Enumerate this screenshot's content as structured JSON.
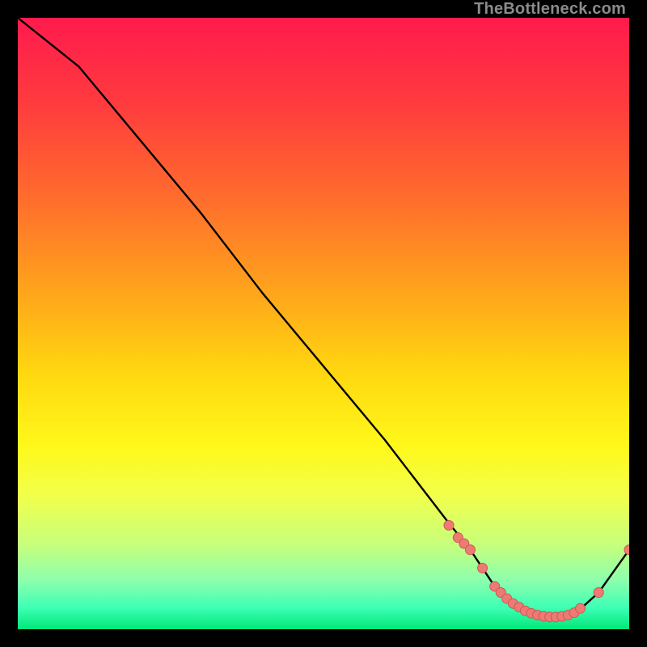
{
  "watermark": "TheBottleneck.com",
  "chart_data": {
    "type": "line",
    "title": "",
    "xlabel": "",
    "ylabel": "",
    "xlim": [
      0,
      100
    ],
    "ylim": [
      0,
      100
    ],
    "series": [
      {
        "name": "curve",
        "x": [
          0,
          5,
          10,
          20,
          30,
          40,
          50,
          60,
          70,
          74,
          78,
          80,
          82,
          85,
          88,
          90,
          92,
          95,
          100
        ],
        "y": [
          100,
          96,
          92,
          80,
          68,
          55,
          43,
          31,
          18,
          13,
          7,
          5,
          3.5,
          2.2,
          2.0,
          2.3,
          3.3,
          6.0,
          13
        ]
      }
    ],
    "markers": {
      "name": "dots",
      "x": [
        70.5,
        72,
        73,
        74,
        76,
        78,
        79,
        80,
        81,
        82,
        83,
        84,
        85,
        86,
        87,
        88,
        89,
        90,
        91,
        92,
        95,
        100
      ],
      "y": [
        17,
        15,
        14,
        13,
        10,
        7,
        6,
        5,
        4.2,
        3.6,
        3.0,
        2.6,
        2.3,
        2.1,
        2.0,
        2.0,
        2.1,
        2.3,
        2.7,
        3.4,
        6.0,
        13
      ]
    },
    "gradient_stops": [
      {
        "offset": 0.0,
        "color": "#ff1a4d"
      },
      {
        "offset": 0.14,
        "color": "#ff3b3e"
      },
      {
        "offset": 0.3,
        "color": "#ff6e2c"
      },
      {
        "offset": 0.45,
        "color": "#ffa51b"
      },
      {
        "offset": 0.58,
        "color": "#ffd710"
      },
      {
        "offset": 0.7,
        "color": "#fff81a"
      },
      {
        "offset": 0.78,
        "color": "#f2ff4a"
      },
      {
        "offset": 0.86,
        "color": "#c8ff7a"
      },
      {
        "offset": 0.92,
        "color": "#8dffad"
      },
      {
        "offset": 0.965,
        "color": "#3dffb4"
      },
      {
        "offset": 1.0,
        "color": "#00e879"
      }
    ],
    "colors": {
      "curve": "#000000",
      "marker_fill": "#ef7a74",
      "marker_stroke": "#c95a54",
      "background_border": "#000000"
    }
  }
}
